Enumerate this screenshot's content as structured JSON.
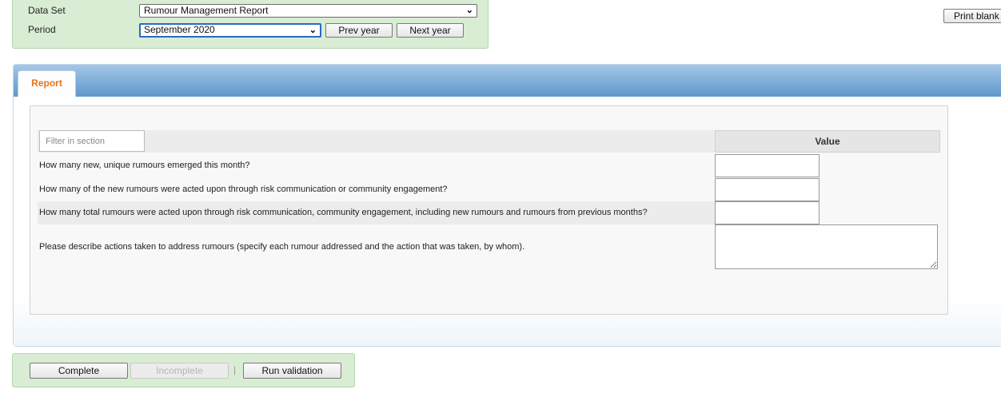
{
  "top_panel": {
    "data_set_label": "Data Set",
    "data_set_value": "Rumour Management Report",
    "period_label": "Period",
    "period_value": "September 2020",
    "prev_year_label": "Prev year",
    "next_year_label": "Next year"
  },
  "print_blank_label": "Print blank",
  "tab": {
    "label": "Report"
  },
  "section": {
    "filter_placeholder": "Filter in section",
    "value_header": "Value",
    "questions": [
      {
        "label": "How many new, unique rumours emerged this month?",
        "value": ""
      },
      {
        "label": "How many of the new rumours were acted upon through risk communication or community engagement?",
        "value": ""
      },
      {
        "label": "How many total rumours were acted upon through risk communication, community engagement, including new rumours and rumours from previous months?",
        "value": ""
      },
      {
        "label": "Please describe actions taken to address rumours (specify each rumour addressed and the action that was taken, by whom).",
        "value": ""
      }
    ]
  },
  "actions": {
    "complete_label": "Complete",
    "incomplete_label": "Incomplete",
    "separator": "|",
    "run_validation_label": "Run validation"
  },
  "icons": {
    "dropdown": "chevron-down-icon",
    "resize": "resize-grip-icon"
  },
  "colors": {
    "tab_text": "#e2761a",
    "panel_green": "#d9ecd4",
    "tab_strip_blue": "#84b1da"
  }
}
